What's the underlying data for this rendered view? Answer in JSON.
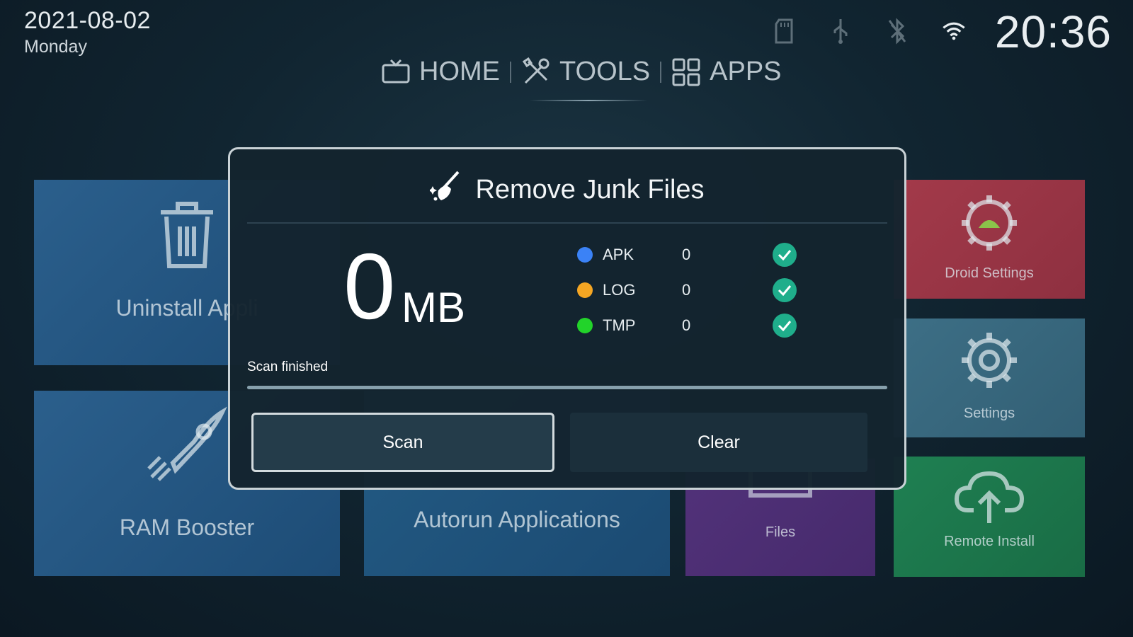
{
  "status_bar": {
    "date": "2021-08-02",
    "weekday": "Monday",
    "clock": "20:36",
    "icons": [
      "sd-card-icon",
      "usb-icon",
      "bluetooth-icon",
      "wifi-icon"
    ]
  },
  "nav": {
    "tabs": [
      {
        "label": "HOME",
        "icon": "tv-icon"
      },
      {
        "label": "TOOLS",
        "icon": "tools-icon",
        "active": true
      },
      {
        "label": "APPS",
        "icon": "apps-grid-icon"
      }
    ]
  },
  "tiles": {
    "uninstall": "Uninstall Appli",
    "ram_booster": "RAM Booster",
    "autorun": "Autorun Applications",
    "files": "Files",
    "droid_settings": "Droid Settings",
    "settings": "Settings",
    "remote_install": "Remote Install"
  },
  "dialog": {
    "title": "Remove Junk Files",
    "title_icon": "broom-icon",
    "total_size": "0",
    "total_unit": "MB",
    "categories": [
      {
        "name": "APK",
        "count": "0",
        "color": "#3b82f6",
        "checked": true
      },
      {
        "name": "LOG",
        "count": "0",
        "color": "#f5a623",
        "checked": true
      },
      {
        "name": "TMP",
        "count": "0",
        "color": "#22d32a",
        "checked": true
      }
    ],
    "status": "Scan finished",
    "progress": 1.0,
    "buttons": {
      "scan": "Scan",
      "clear": "Clear"
    }
  },
  "colors": {
    "check": "#1fae8b",
    "tile_blue": "#2b5f8c",
    "tile_red": "#a33a4a",
    "tile_green": "#1f8052",
    "tile_purple": "#52327a"
  }
}
